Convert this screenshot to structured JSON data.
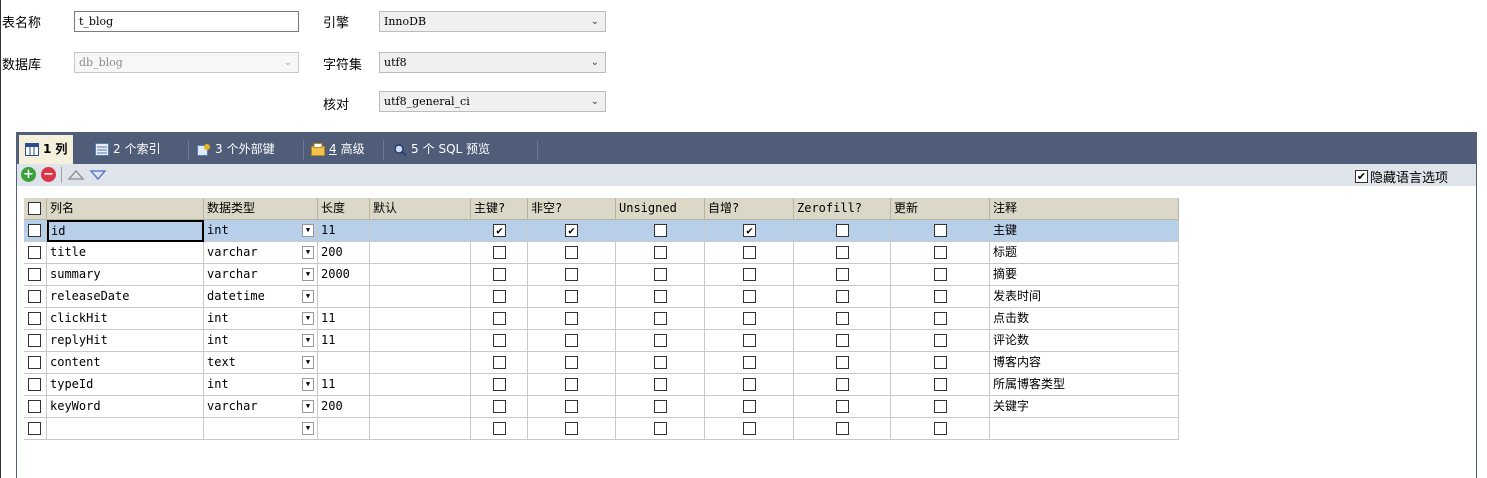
{
  "form": {
    "table_name_label": "表名称",
    "table_name_value": "t_blog",
    "database_label": "数据库",
    "database_value": "db_blog",
    "engine_label": "引擎",
    "engine_value": "InnoDB",
    "charset_label": "字符集",
    "charset_value": "utf8",
    "collation_label": "核对",
    "collation_value": "utf8_general_ci"
  },
  "tabs": [
    {
      "num": "1",
      "label": "列"
    },
    {
      "num": "2",
      "label": "个索引"
    },
    {
      "num": "3",
      "label": "个外部键"
    },
    {
      "num": "4",
      "label": "高级"
    },
    {
      "num": "5",
      "label": "个 SQL 预览"
    }
  ],
  "toolbar": {
    "hide_lang_label": "隐藏语言选项",
    "hide_lang_checked": true
  },
  "grid": {
    "headers": [
      "列名",
      "数据类型",
      "长度",
      "默认",
      "主键?",
      "非空?",
      "Unsigned",
      "自增?",
      "Zerofill?",
      "更新",
      "注释"
    ],
    "rows": [
      {
        "name": "id",
        "type": "int",
        "length": "11",
        "default": "",
        "pk": true,
        "notnull": true,
        "unsigned": false,
        "ai": true,
        "zerofill": false,
        "update": false,
        "comment": "主键",
        "selected": true
      },
      {
        "name": "title",
        "type": "varchar",
        "length": "200",
        "default": "",
        "pk": false,
        "notnull": false,
        "unsigned": false,
        "ai": false,
        "zerofill": false,
        "update": false,
        "comment": "标题"
      },
      {
        "name": "summary",
        "type": "varchar",
        "length": "2000",
        "default": "",
        "pk": false,
        "notnull": false,
        "unsigned": false,
        "ai": false,
        "zerofill": false,
        "update": false,
        "comment": "摘要"
      },
      {
        "name": "releaseDate",
        "type": "datetime",
        "length": "",
        "default": "",
        "pk": false,
        "notnull": false,
        "unsigned": false,
        "ai": false,
        "zerofill": false,
        "update": false,
        "comment": "发表时间"
      },
      {
        "name": "clickHit",
        "type": "int",
        "length": "11",
        "default": "",
        "pk": false,
        "notnull": false,
        "unsigned": false,
        "ai": false,
        "zerofill": false,
        "update": false,
        "comment": "点击数"
      },
      {
        "name": "replyHit",
        "type": "int",
        "length": "11",
        "default": "",
        "pk": false,
        "notnull": false,
        "unsigned": false,
        "ai": false,
        "zerofill": false,
        "update": false,
        "comment": "评论数"
      },
      {
        "name": "content",
        "type": "text",
        "length": "",
        "default": "",
        "pk": false,
        "notnull": false,
        "unsigned": false,
        "ai": false,
        "zerofill": false,
        "update": false,
        "comment": "博客内容"
      },
      {
        "name": "typeId",
        "type": "int",
        "length": "11",
        "default": "",
        "pk": false,
        "notnull": false,
        "unsigned": false,
        "ai": false,
        "zerofill": false,
        "update": false,
        "comment": "所属博客类型"
      },
      {
        "name": "keyWord",
        "type": "varchar",
        "length": "200",
        "default": "",
        "pk": false,
        "notnull": false,
        "unsigned": false,
        "ai": false,
        "zerofill": false,
        "update": false,
        "comment": "关键字"
      },
      {
        "name": "",
        "type": "",
        "length": "",
        "default": "",
        "pk": false,
        "notnull": false,
        "unsigned": false,
        "ai": false,
        "zerofill": false,
        "update": false,
        "comment": ""
      }
    ]
  },
  "icons": {
    "add": "add-icon",
    "remove": "remove-icon",
    "move_up": "triangle-up-icon",
    "move_down": "triangle-down-icon",
    "checkmark": "✔",
    "dropdown": "▼",
    "chevron": "⌄"
  },
  "colors": {
    "tabbar": "#4f5d78",
    "active_tab": "#f4f0dc",
    "selected_row": "#b8cfea",
    "header": "#dcd8c8",
    "add": "#3aa13a",
    "remove": "#d9364a"
  }
}
